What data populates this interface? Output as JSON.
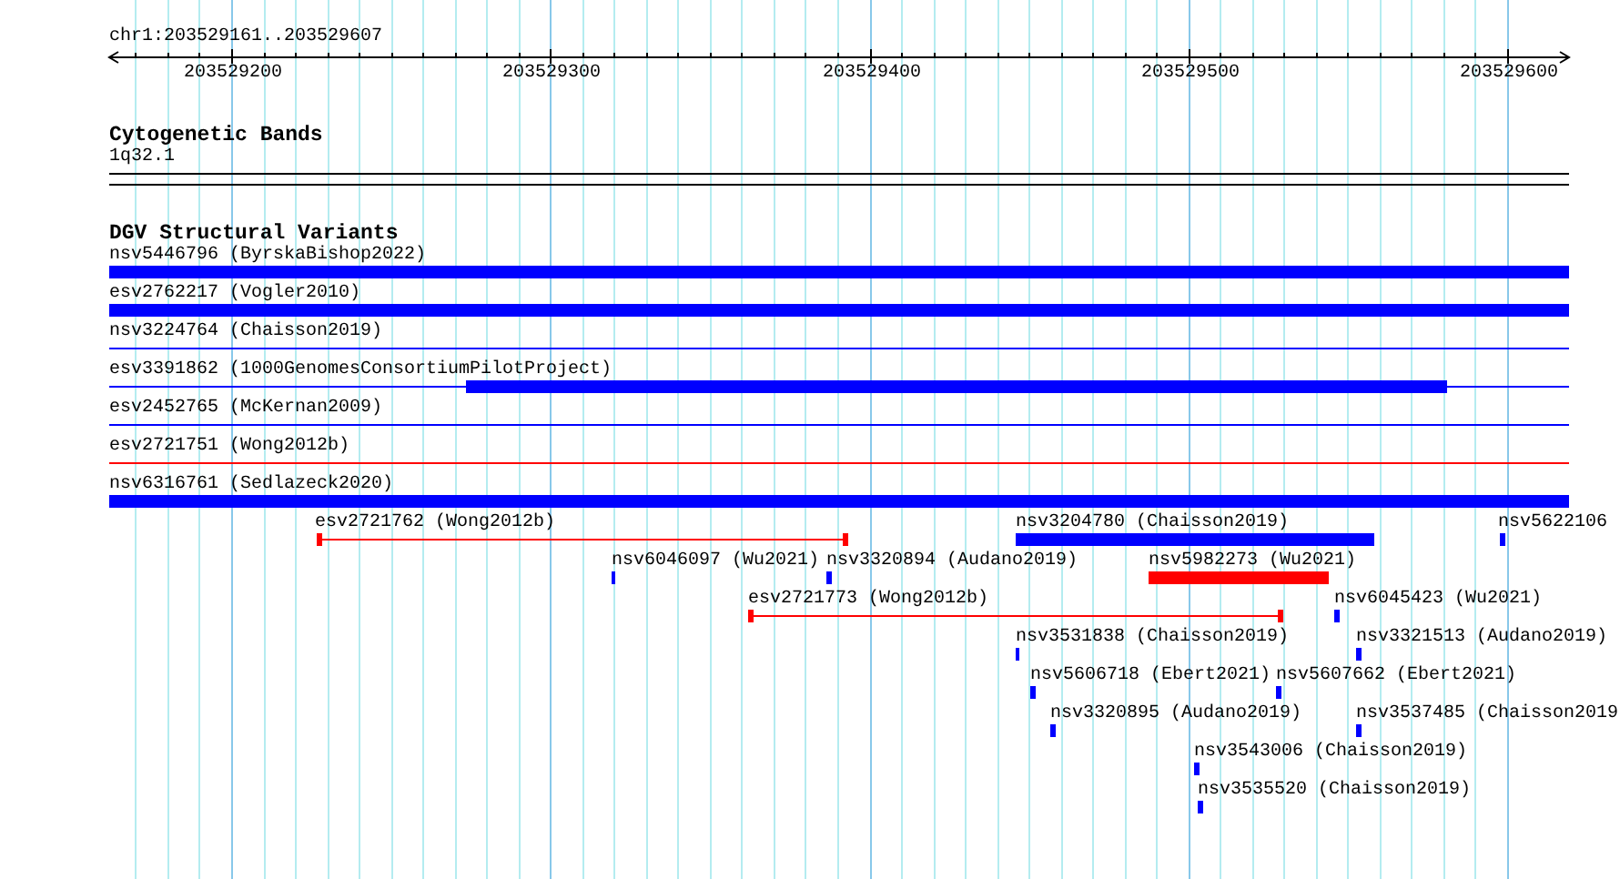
{
  "location": "chr1:203529161..203529607",
  "ruler": {
    "ticks": [
      "203529200",
      "203529300",
      "203529400",
      "203529500",
      "203529600"
    ]
  },
  "cytogenetic_bands": {
    "title": "Cytogenetic Bands",
    "band": "1q32.1"
  },
  "structural_variants": {
    "title": "DGV Structural Variants",
    "lanes": [
      {
        "features": [
          {
            "label": "nsv5446796 (ByrskaBishop2022)",
            "kind": "thick",
            "color": "#0000ff"
          }
        ]
      },
      {
        "features": [
          {
            "label": "esv2762217 (Vogler2010)",
            "kind": "thick",
            "color": "#0000ff"
          }
        ]
      },
      {
        "features": [
          {
            "label": "nsv3224764 (Chaisson2019)",
            "kind": "thin",
            "color": "#0000ff"
          }
        ]
      },
      {
        "features": [
          {
            "label": "esv3391862 (1000GenomesConsortiumPilotProject)",
            "kind": "partial",
            "color": "#0000ff"
          }
        ]
      },
      {
        "features": [
          {
            "label": "esv2452765 (McKernan2009)",
            "kind": "thin",
            "color": "#0000ff"
          }
        ]
      },
      {
        "features": [
          {
            "label": "esv2721751 (Wong2012b)",
            "kind": "thin",
            "color": "#ff0000"
          }
        ]
      },
      {
        "features": [
          {
            "label": "nsv6316761 (Sedlazeck2020)",
            "kind": "thick",
            "color": "#0000ff"
          }
        ]
      },
      {
        "features": [
          {
            "label": "esv2721762 (Wong2012b)",
            "kind": "capped",
            "color": "#ff0000"
          },
          {
            "label": "nsv3204780 (Chaisson2019)",
            "kind": "thick",
            "color": "#0000ff"
          },
          {
            "label": "nsv5622106",
            "kind": "thick",
            "color": "#0000ff"
          }
        ]
      },
      {
        "features": [
          {
            "label": "nsv6046097 (Wu2021)",
            "kind": "thick",
            "color": "#0000ff"
          },
          {
            "label": "nsv3320894 (Audano2019)",
            "kind": "thick",
            "color": "#0000ff"
          },
          {
            "label": "nsv5982273 (Wu2021)",
            "kind": "thick",
            "color": "#ff0000"
          }
        ]
      },
      {
        "features": [
          {
            "label": "esv2721773 (Wong2012b)",
            "kind": "capped",
            "color": "#ff0000"
          },
          {
            "label": "nsv6045423 (Wu2021)",
            "kind": "thick",
            "color": "#0000ff"
          }
        ]
      },
      {
        "features": [
          {
            "label": "nsv3531838 (Chaisson2019)",
            "kind": "thick",
            "color": "#0000ff"
          },
          {
            "label": "nsv3321513 (Audano2019)",
            "kind": "thick",
            "color": "#0000ff"
          }
        ]
      },
      {
        "features": [
          {
            "label": "nsv5606718 (Ebert2021)",
            "kind": "thick",
            "color": "#0000ff"
          },
          {
            "label": "nsv5607662 (Ebert2021)",
            "kind": "thick",
            "color": "#0000ff"
          }
        ]
      },
      {
        "features": [
          {
            "label": "nsv3320895 (Audano2019)",
            "kind": "thick",
            "color": "#0000ff"
          },
          {
            "label": "nsv3537485 (Chaisson2019",
            "kind": "thick",
            "color": "#0000ff"
          }
        ]
      },
      {
        "features": [
          {
            "label": "nsv3543006 (Chaisson2019)",
            "kind": "thick",
            "color": "#0000ff"
          }
        ]
      },
      {
        "features": [
          {
            "label": "nsv3535520 (Chaisson2019)",
            "kind": "thick",
            "color": "#0000ff"
          }
        ]
      }
    ]
  }
}
